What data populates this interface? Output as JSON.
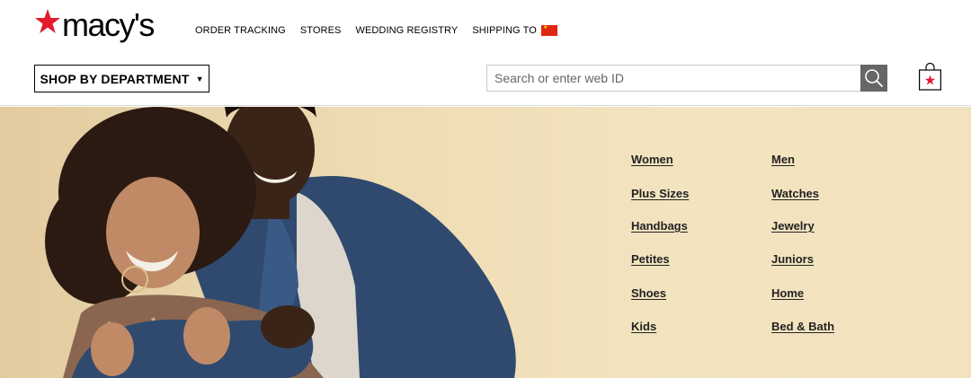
{
  "brand": {
    "wordmark": "macy's",
    "accent_color": "#e21a2c"
  },
  "utility_nav": {
    "order_tracking": "ORDER TRACKING",
    "stores": "STORES",
    "wedding_registry": "WEDDING REGISTRY",
    "shipping_to": "SHIPPING TO",
    "shipping_flag": "china-flag-icon"
  },
  "department_button": {
    "label": "SHOP BY DEPARTMENT",
    "caret": "▼"
  },
  "search": {
    "placeholder": "Search or enter web ID",
    "value": "",
    "button_icon": "search-icon"
  },
  "bag": {
    "icon": "shopping-bag-icon"
  },
  "hero": {
    "image": "couple-embracing-photo",
    "categories": {
      "left": [
        "Women",
        "Plus Sizes",
        "Handbags",
        "Petites",
        "Shoes",
        "Kids"
      ],
      "right": [
        "Men",
        "Watches",
        "Jewelry",
        "Juniors",
        "Home",
        "Bed & Bath"
      ]
    }
  }
}
